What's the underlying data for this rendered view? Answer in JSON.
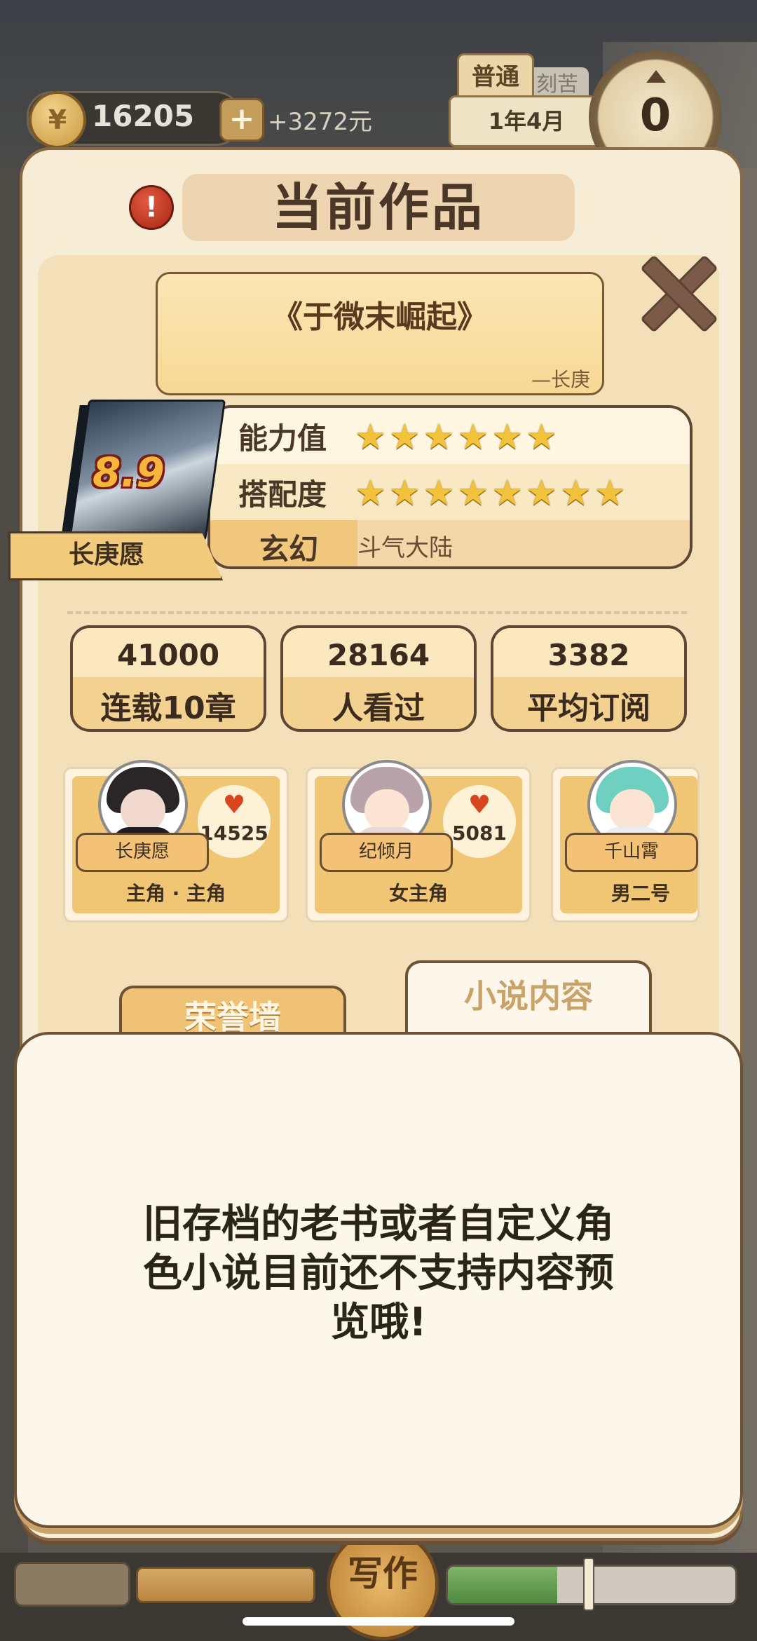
{
  "hud": {
    "coins": "16205",
    "plus": "+",
    "income": "+3272元",
    "mode_tab": "普通",
    "mode_tab2": "刻苦",
    "date": "1年4月",
    "level": "0",
    "write_button": "写作",
    "progress_fraction": 0.38
  },
  "dialog": {
    "title": "当前作品",
    "alert_symbol": "!",
    "book_title": "《于微末崛起》",
    "author_line": "—长庚",
    "cover_score": "8.9",
    "cover_ribbon": "长庚愿",
    "stats": {
      "ability_label": "能力值",
      "ability_stars": 6,
      "match_label": "搭配度",
      "match_stars": 8,
      "genre": "玄幻",
      "setting": "斗气大陆"
    },
    "metrics": [
      {
        "value": "41000",
        "label": "连载10章"
      },
      {
        "value": "28164",
        "label": "人看过"
      },
      {
        "value": "3382",
        "label": "平均订阅"
      }
    ],
    "characters": [
      {
        "name": "长庚愿",
        "likes": "14525",
        "role": "主角 · 主角"
      },
      {
        "name": "纪倾月",
        "likes": "5081",
        "role": "女主角"
      },
      {
        "name": "千山霄",
        "likes": "",
        "role": "男二号"
      }
    ],
    "tabs": {
      "honor": "荣誉墙",
      "novel": "小说内容"
    },
    "content_message": "旧存档的老书或者自定义角色小说目前还不支持内容预览哦!"
  },
  "colors": {
    "accent": "#f0c276",
    "text_dark": "#3b2b1e",
    "star": "#f2c23b"
  }
}
